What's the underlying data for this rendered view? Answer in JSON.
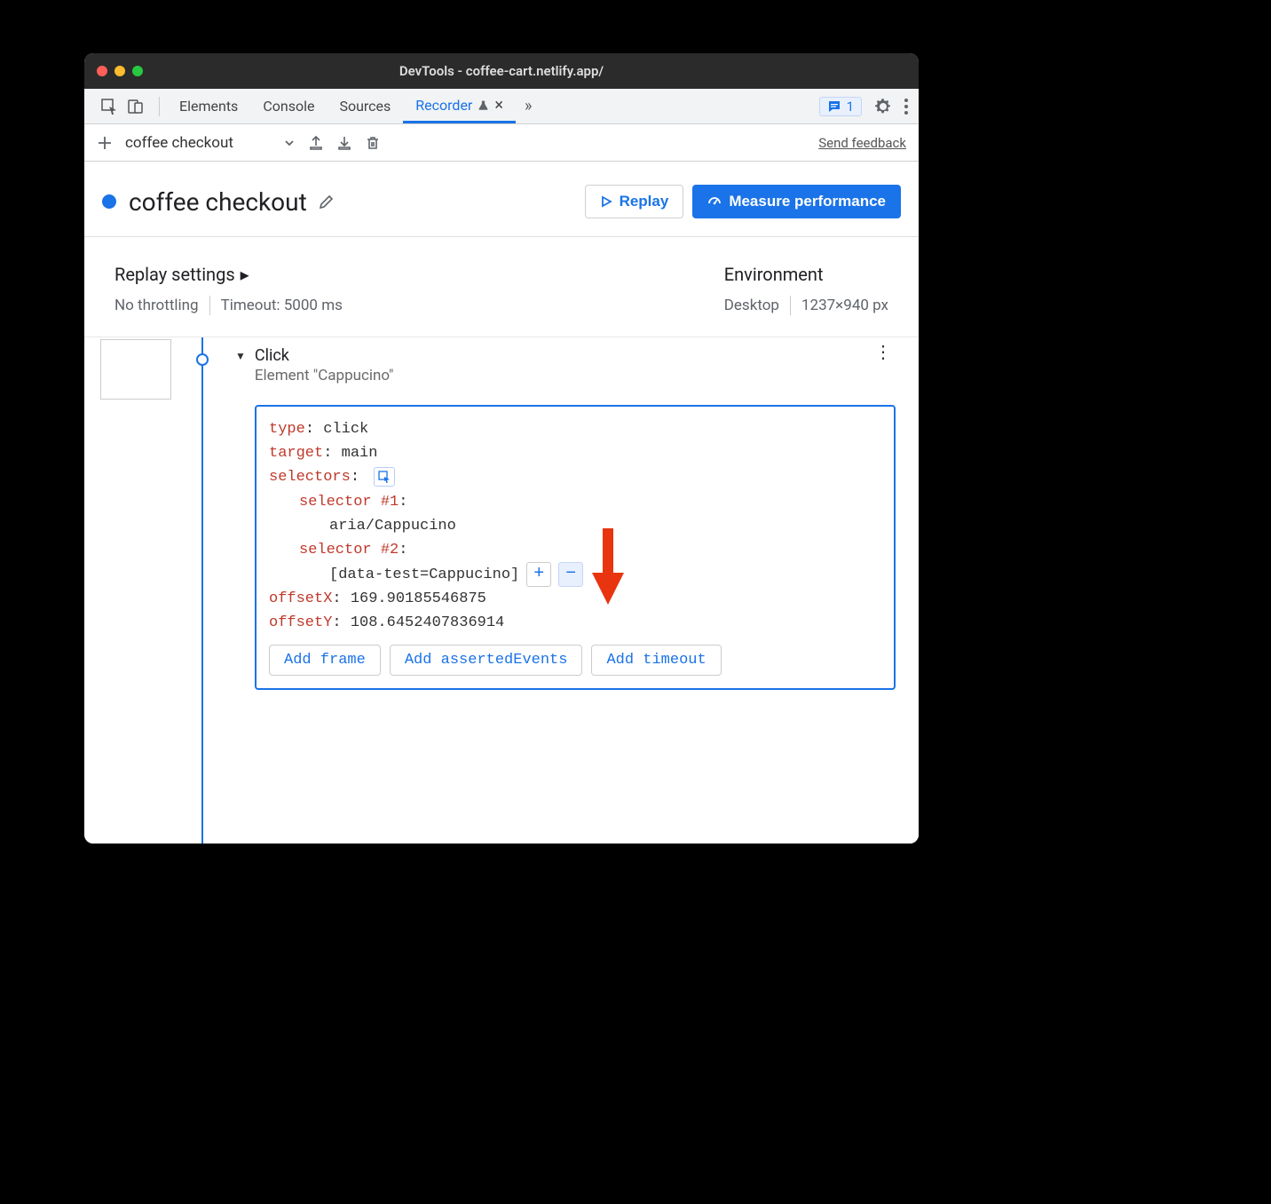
{
  "window": {
    "title": "DevTools - coffee-cart.netlify.app/"
  },
  "tabs": {
    "items": [
      "Elements",
      "Console",
      "Sources",
      "Recorder"
    ],
    "active": "Recorder",
    "issues_count": "1"
  },
  "subbar": {
    "recording_name": "coffee checkout",
    "send_feedback": "Send feedback"
  },
  "header": {
    "title": "coffee checkout",
    "replay_label": "Replay",
    "measure_label": "Measure performance"
  },
  "settings": {
    "replay_heading": "Replay settings",
    "throttling": "No throttling",
    "timeout": "Timeout: 5000 ms",
    "env_heading": "Environment",
    "device": "Desktop",
    "viewport": "1237×940 px"
  },
  "step": {
    "title": "Click",
    "subtitle": "Element \"Cappucino\"",
    "props": {
      "type_key": "type",
      "type_val": "click",
      "target_key": "target",
      "target_val": "main",
      "selectors_key": "selectors",
      "sel1_key": "selector #1",
      "sel1_val": "aria/Cappucino",
      "sel2_key": "selector #2",
      "sel2_val": "[data-test=Cappucino]",
      "offsetX_key": "offsetX",
      "offsetX_val": "169.90185546875",
      "offsetY_key": "offsetY",
      "offsetY_val": "108.6452407836914"
    },
    "add_buttons": [
      "Add frame",
      "Add assertedEvents",
      "Add timeout"
    ]
  }
}
